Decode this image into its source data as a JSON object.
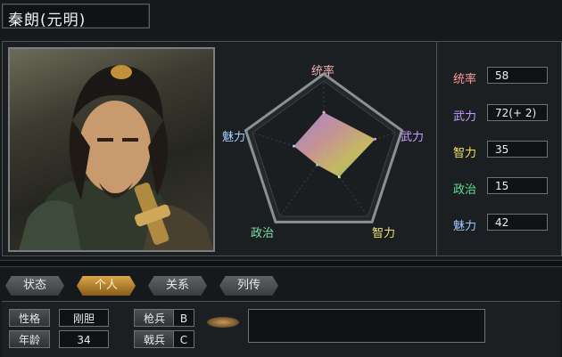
{
  "officer": {
    "name": "秦朗(元明)"
  },
  "radar": {
    "labels": {
      "top": "统率",
      "right": "武力",
      "bottom_right": "智力",
      "bottom_left": "政治",
      "left": "魅力"
    },
    "values": {
      "tong": 58,
      "wu": 72,
      "zhi": 35,
      "zheng": 15,
      "mei": 42
    },
    "max": 100,
    "colors": {
      "tong": "#f0b0b0",
      "wu": "#c8a0ff",
      "zhi": "#f0e070",
      "zheng": "#7fe0a8",
      "mei": "#a8d0ff"
    }
  },
  "stats": [
    {
      "label": "统率",
      "value": "58",
      "color": "#ff9a9a"
    },
    {
      "label": "武力",
      "value": "72(+ 2)",
      "color": "#c79bff"
    },
    {
      "label": "智力",
      "value": "35",
      "color": "#f2e060"
    },
    {
      "label": "政治",
      "value": "15",
      "color": "#5fe08f"
    },
    {
      "label": "魅力",
      "value": "42",
      "color": "#9fc8ff"
    }
  ],
  "tabs": [
    {
      "label": "状态",
      "active": false
    },
    {
      "label": "个人",
      "active": true
    },
    {
      "label": "关系",
      "active": false
    },
    {
      "label": "列传",
      "active": false
    }
  ],
  "personal": [
    {
      "label": "性格",
      "value": "刚胆"
    },
    {
      "label": "年龄",
      "value": "34"
    }
  ],
  "aptitude": [
    {
      "label": "枪兵",
      "value": "B"
    },
    {
      "label": "戟兵",
      "value": "C"
    }
  ]
}
